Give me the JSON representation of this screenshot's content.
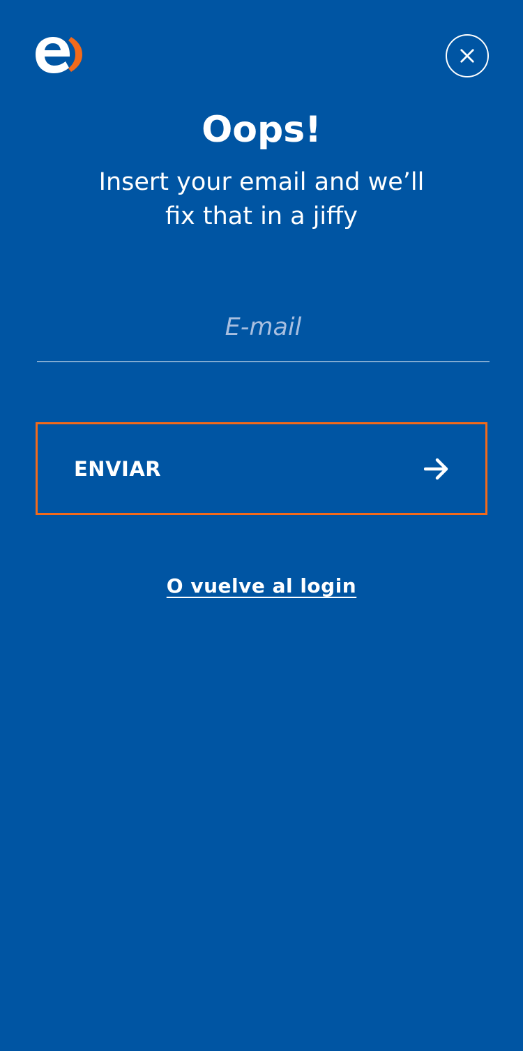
{
  "brand": {
    "logo_icon": "brand-logo-e",
    "colors": {
      "background": "#0055A3",
      "accent": "#F26A1B",
      "text": "#FFFFFF",
      "placeholder": "#A8BFE0"
    }
  },
  "header": {
    "close_icon": "close-icon"
  },
  "main": {
    "title": "Oops!",
    "subtitle": "Insert your email and we’ll fix that in a jiffy"
  },
  "form": {
    "email_placeholder": "E-mail",
    "email_value": "",
    "submit_label": "ENVIAR",
    "submit_icon": "arrow-right-icon"
  },
  "footer": {
    "back_link_label": "O vuelve al login"
  }
}
